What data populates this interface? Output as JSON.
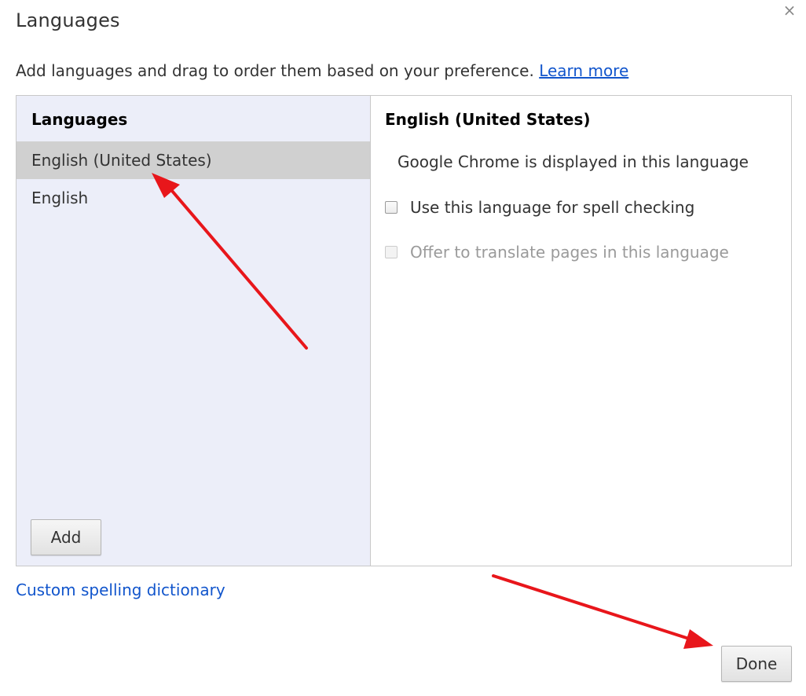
{
  "dialog": {
    "title": "Languages",
    "close_glyph": "×",
    "intro_text": "Add languages and drag to order them based on your preference.",
    "learn_more_label": "Learn more"
  },
  "languages_list": {
    "header": "Languages",
    "items": [
      {
        "label": "English (United States)",
        "selected": true
      },
      {
        "label": "English",
        "selected": false
      }
    ],
    "add_label": "Add"
  },
  "details": {
    "title": "English (United States)",
    "display_info": "Google Chrome is displayed in this language",
    "spell_check_label": "Use this language for spell checking",
    "spell_check_checked": false,
    "translate_label": "Offer to translate pages in this language",
    "translate_checked": false,
    "translate_disabled": true
  },
  "footer": {
    "custom_dictionary_label": "Custom spelling dictionary",
    "done_label": "Done"
  },
  "colors": {
    "link": "#1155cc",
    "list_background": "#eceef9",
    "selected_row": "#d0d0d0",
    "annotation_arrow": "#e8161b"
  },
  "icons": {
    "close": "close-icon",
    "arrow": "annotation-arrow"
  }
}
